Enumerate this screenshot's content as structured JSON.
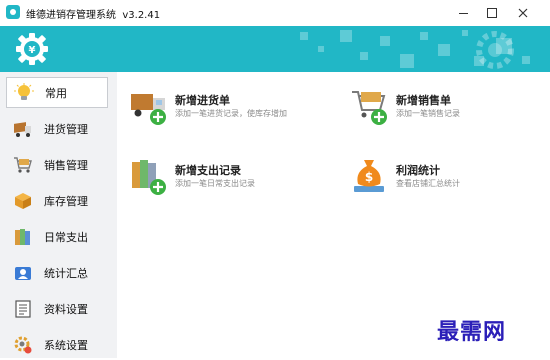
{
  "window": {
    "title": "维德进销存管理系统",
    "version": "v3.2.41"
  },
  "colors": {
    "header": "#21b7c6",
    "sidebar": "#f1f2f4",
    "watermark": "#2b1fb8"
  },
  "sidebar": {
    "items": [
      {
        "label": "常用",
        "icon": "lightbulb-icon",
        "active": true
      },
      {
        "label": "进货管理",
        "icon": "truck-icon",
        "active": false
      },
      {
        "label": "销售管理",
        "icon": "shopping-cart-icon",
        "active": false
      },
      {
        "label": "库存管理",
        "icon": "box-icon",
        "active": false
      },
      {
        "label": "日常支出",
        "icon": "binders-icon",
        "active": false
      },
      {
        "label": "统计汇总",
        "icon": "chart-user-icon",
        "active": false
      },
      {
        "label": "资料设置",
        "icon": "document-icon",
        "active": false
      },
      {
        "label": "系统设置",
        "icon": "gear-icon",
        "active": false
      }
    ]
  },
  "main": {
    "cards": [
      {
        "title": "新增进货单",
        "desc": "添加一笔进货记录，使库存增加",
        "icon": "truck-add-icon"
      },
      {
        "title": "新增销售单",
        "desc": "添加一笔销售记录",
        "icon": "cart-add-icon"
      },
      {
        "title": "新增支出记录",
        "desc": "添加一笔日常支出记录",
        "icon": "binders-add-icon"
      },
      {
        "title": "利润统计",
        "desc": "查看店铺汇总统计",
        "icon": "money-bag-icon"
      }
    ]
  },
  "watermark": "最需网"
}
